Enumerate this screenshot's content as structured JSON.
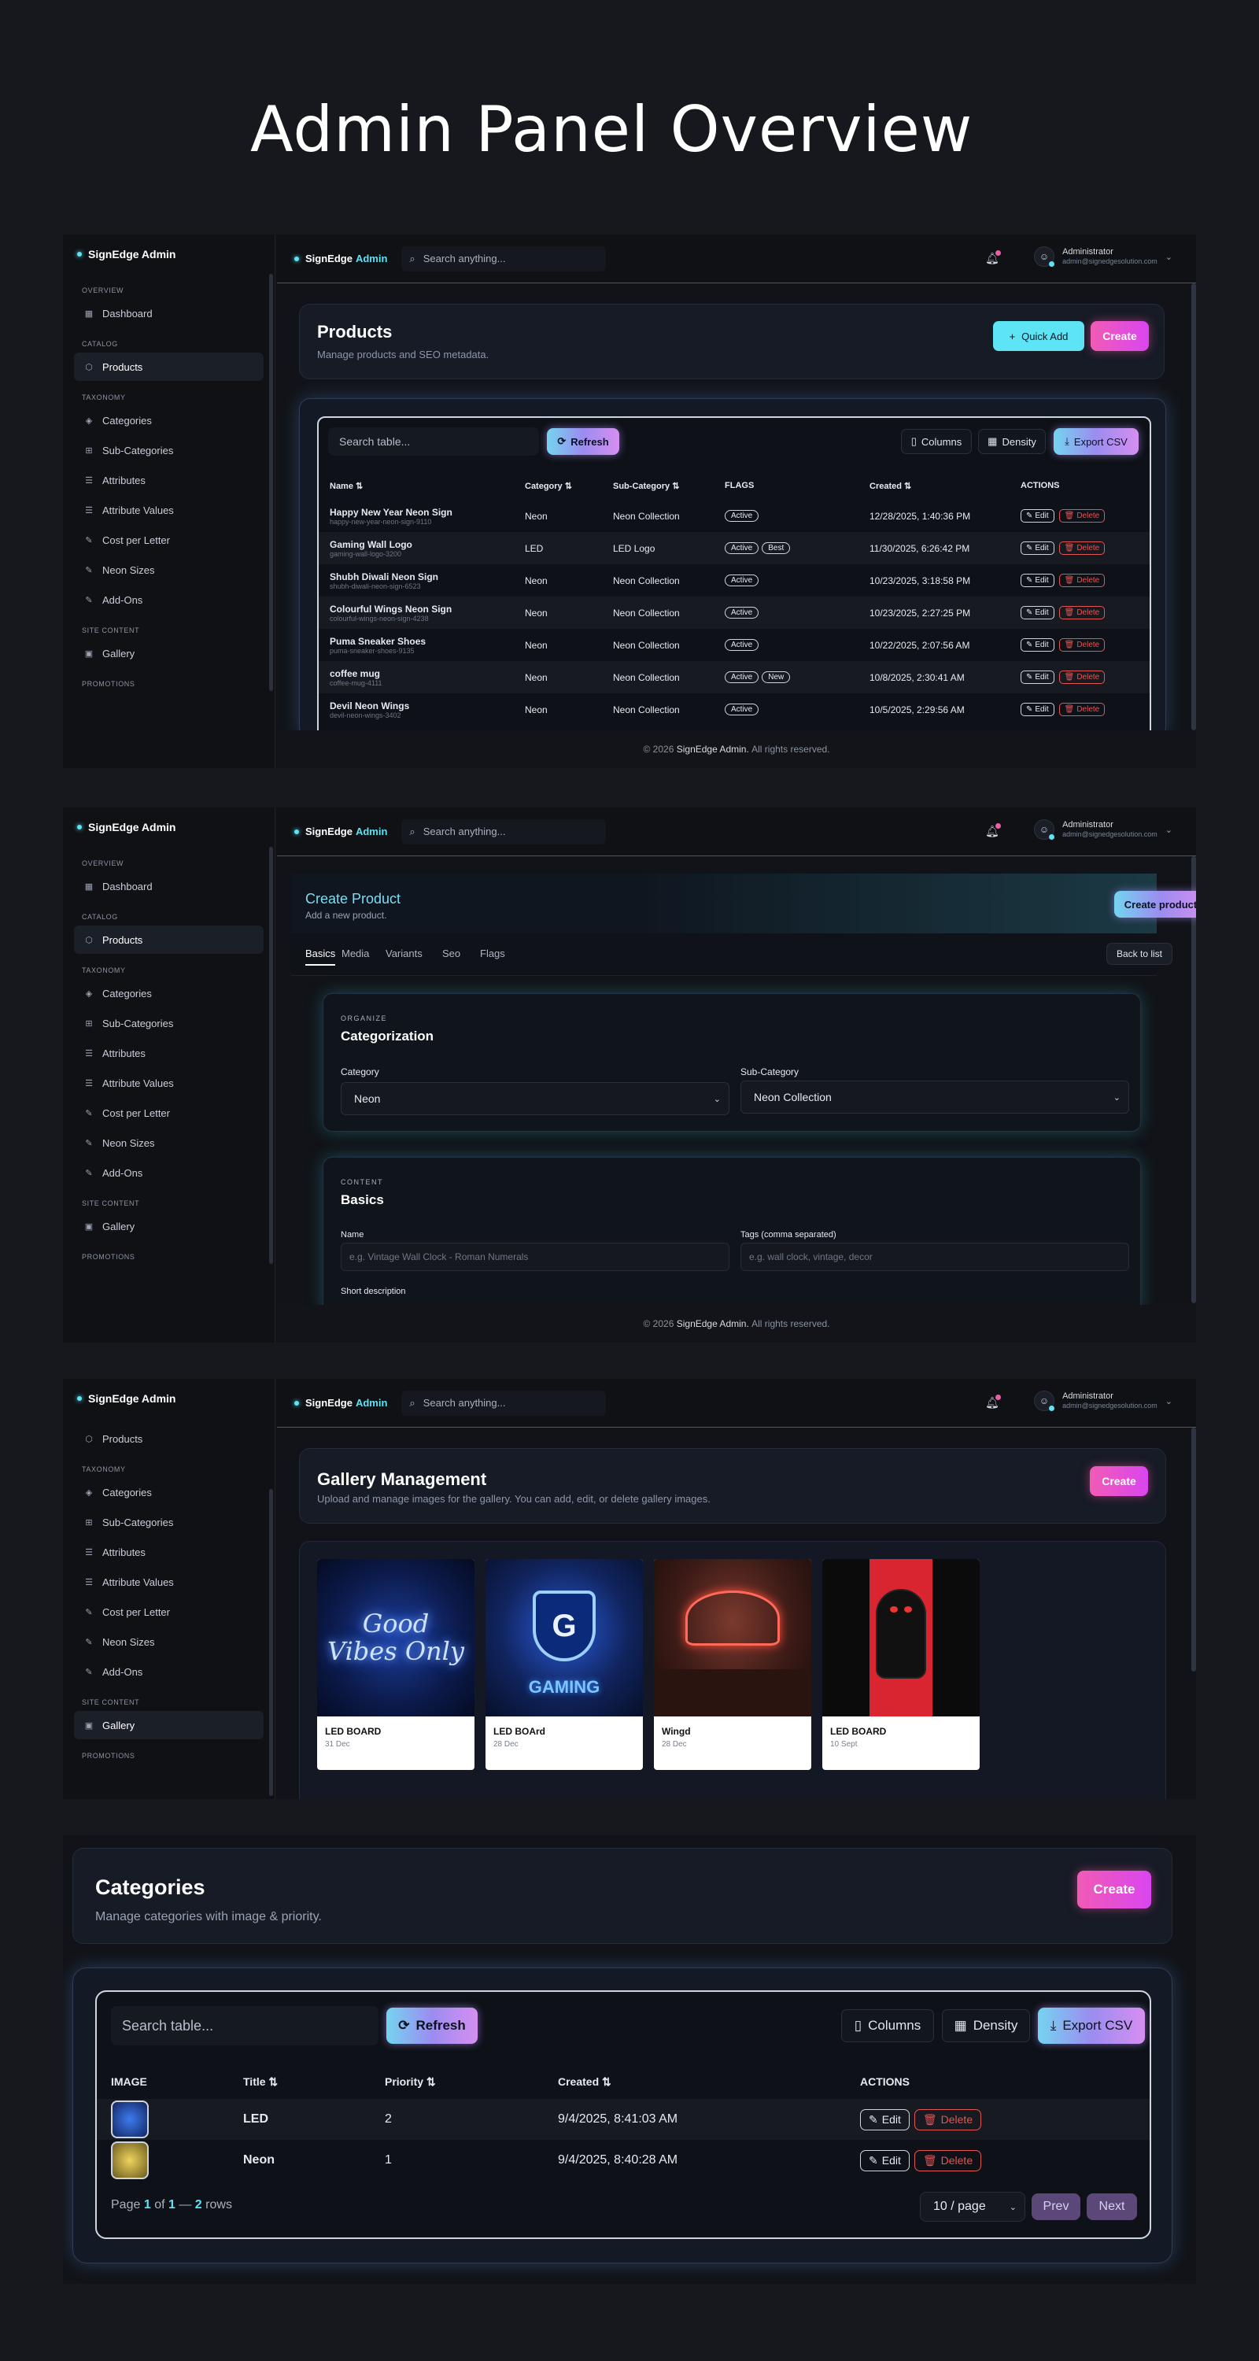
{
  "page_title": "Admin Panel Overview",
  "brand": {
    "name": "SignEdge",
    "admin": "Admin",
    "full": "SignEdge Admin"
  },
  "topbar": {
    "search_placeholder": "Search anything...",
    "user_name": "Administrator",
    "user_email": "admin@signedgesolution.com"
  },
  "footer": {
    "prefix": "© 2026",
    "brand": "SignEdge Admin.",
    "suffix": "All rights reserved."
  },
  "sidebar": {
    "sections": {
      "overview": "OVERVIEW",
      "catalog": "CATALOG",
      "taxonomy": "TAXONOMY",
      "site": "SITE CONTENT",
      "promotions": "PROMOTIONS"
    },
    "items": {
      "dashboard": "Dashboard",
      "products": "Products",
      "categories": "Categories",
      "subcategories": "Sub-Categories",
      "attributes": "Attributes",
      "attribute_values": "Attribute Values",
      "cost_per_letter": "Cost per Letter",
      "neon_sizes": "Neon Sizes",
      "addons": "Add-Ons",
      "gallery": "Gallery"
    }
  },
  "products": {
    "title": "Products",
    "subtitle": "Manage products and SEO metadata.",
    "quick_add": "Quick Add",
    "create": "Create",
    "search_placeholder": "Search table...",
    "refresh": "Refresh",
    "columns": "Columns",
    "density": "Density",
    "export": "Export CSV",
    "headers": {
      "name": "Name",
      "category": "Category",
      "subcategory": "Sub-Category",
      "flags": "FLAGS",
      "created": "Created",
      "actions": "ACTIONS"
    },
    "edit": "Edit",
    "delete": "Delete",
    "rows": [
      {
        "name": "Happy New Year Neon Sign",
        "slug": "happy-new-year-neon-sign-9110",
        "category": "Neon",
        "subcategory": "Neon Collection",
        "flags": [
          "Active"
        ],
        "created": "12/28/2025, 1:40:36 PM"
      },
      {
        "name": "Gaming Wall Logo",
        "slug": "gaming-wall-logo-3200",
        "category": "LED",
        "subcategory": "LED Logo",
        "flags": [
          "Active",
          "Best"
        ],
        "created": "11/30/2025, 6:26:42 PM"
      },
      {
        "name": "Shubh Diwali Neon Sign",
        "slug": "shubh-diwali-neon-sign-6523",
        "category": "Neon",
        "subcategory": "Neon Collection",
        "flags": [
          "Active"
        ],
        "created": "10/23/2025, 3:18:58 PM"
      },
      {
        "name": "Colourful Wings Neon Sign",
        "slug": "colourful-wings-neon-sign-4238",
        "category": "Neon",
        "subcategory": "Neon Collection",
        "flags": [
          "Active"
        ],
        "created": "10/23/2025, 2:27:25 PM"
      },
      {
        "name": "Puma Sneaker Shoes",
        "slug": "puma-sneaker-shoes-9135",
        "category": "Neon",
        "subcategory": "Neon Collection",
        "flags": [
          "Active"
        ],
        "created": "10/22/2025, 2:07:56 AM"
      },
      {
        "name": "coffee mug",
        "slug": "coffee-mug-4111",
        "category": "Neon",
        "subcategory": "Neon Collection",
        "flags": [
          "Active",
          "New"
        ],
        "created": "10/8/2025, 2:30:41 AM"
      },
      {
        "name": "Devil Neon Wings",
        "slug": "devil-neon-wings-3402",
        "category": "Neon",
        "subcategory": "Neon Collection",
        "flags": [
          "Active"
        ],
        "created": "10/5/2025, 2:29:56 AM"
      }
    ]
  },
  "create_product": {
    "title": "Create Product",
    "subtitle": "Add a new product.",
    "create_btn": "Create product",
    "back": "Back to list",
    "tabs": [
      "Basics",
      "Media",
      "Variants",
      "Seo",
      "Flags"
    ],
    "organize_eyebrow": "ORGANIZE",
    "organize_title": "Categorization",
    "category_label": "Category",
    "category_value": "Neon",
    "subcategory_label": "Sub-Category",
    "subcategory_value": "Neon Collection",
    "content_eyebrow": "CONTENT",
    "content_title": "Basics",
    "name_label": "Name",
    "name_placeholder": "e.g. Vintage Wall Clock - Roman Numerals",
    "tags_label": "Tags (comma separated)",
    "tags_placeholder": "e.g. wall clock, vintage, decor",
    "short_desc_label": "Short description"
  },
  "gallery": {
    "title": "Gallery Management",
    "subtitle": "Upload and manage images for the gallery. You can add, edit, or delete gallery images.",
    "create": "Create",
    "items": [
      {
        "title": "LED BOARD",
        "date": "31 Dec",
        "image_text": "Good Vibes Only"
      },
      {
        "title": "LED BOArd",
        "date": "28 Dec",
        "image_text": "GAMING"
      },
      {
        "title": "Wingd",
        "date": "28 Dec"
      },
      {
        "title": "LED BOARD",
        "date": "10 Sept"
      }
    ]
  },
  "categories": {
    "title": "Categories",
    "subtitle": "Manage categories with image & priority.",
    "create": "Create",
    "search_placeholder": "Search table...",
    "refresh": "Refresh",
    "columns": "Columns",
    "density": "Density",
    "export": "Export CSV",
    "headers": {
      "image": "IMAGE",
      "title": "Title",
      "priority": "Priority",
      "created": "Created",
      "actions": "ACTIONS"
    },
    "edit": "Edit",
    "delete": "Delete",
    "rows": [
      {
        "title": "LED",
        "priority": "2",
        "created": "9/4/2025, 8:41:03 AM"
      },
      {
        "title": "Neon",
        "priority": "1",
        "created": "9/4/2025, 8:40:28 AM"
      }
    ],
    "pagination": {
      "page_word": "Page",
      "current": "1",
      "of_word": "of",
      "total_pages": "1",
      "dash": "—",
      "rows": "2",
      "rows_word": "rows",
      "per_page": "10 / page",
      "prev": "Prev",
      "next": "Next"
    }
  }
}
